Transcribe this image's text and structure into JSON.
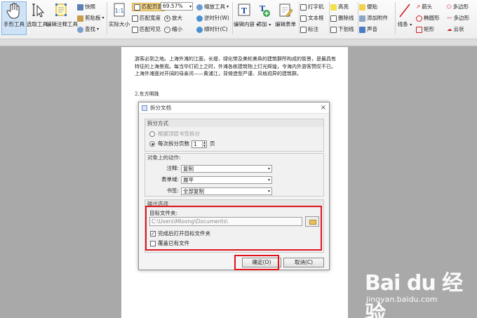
{
  "toolbar": {
    "hand_tool": "手形工具",
    "select_tool": "选取工具",
    "edit_annot_tool": "编辑注释工具",
    "snapshot": "快照",
    "clipboard": "剪贴板",
    "find": "查找",
    "actual_size": "实际大小",
    "fit_page": "匹配页面",
    "fit_width": "匹配宽度",
    "fit_visible": "匹配可见",
    "zoom_value": "69.57%",
    "zoom_in": "放大",
    "zoom_out": "缩小",
    "zoom_tool": "缩放工具",
    "rotate_ccw": "逆时针(W)",
    "rotate_cw": "顺时针(C)",
    "edit_content": "编辑内容",
    "add": "添加",
    "edit_form": "编辑表单",
    "typewriter": "打字机",
    "textbox": "文本框",
    "callout": "标注",
    "highlight": "高亮",
    "strikeout": "删除线",
    "underline": "下划线",
    "sticky_note": "便贴",
    "attach_file": "添加附件",
    "sound": "声音",
    "line": "线条",
    "arrow": "箭头",
    "ellipse": "椭圆形",
    "rectangle": "矩形",
    "polygon": "多边形",
    "polyline": "多边形",
    "cloud": "云状"
  },
  "page": {
    "paragraph": "游客必到之地。上海外滩的江面，长堤、绿化带及美轮美奂的建筑群所构成的街景，是最具有特征的上海景观。每当华灯初上之时，外滩各栋建筑物上灯光辉煌，令海内外游客赞叹不已。上海外滩面对开阔的母亲河——黄浦江，背倚造型严谨、风格迥异的建筑群。",
    "heading": "2.东方明珠"
  },
  "dialog": {
    "title": "拆分文档",
    "close": "×",
    "split_section": "拆分方式",
    "by_bookmark": "根据顶层书签拆分",
    "each_pages_prefix": "每次拆分页数",
    "pages_value": "1",
    "pages_suffix": "页",
    "actions_section": "对象上的动作:",
    "annot_label": "注释:",
    "annot_value": "复制",
    "form_label": "表单域:",
    "form_value": "展平",
    "bookmark_label": "书签:",
    "bookmark_value": "全部复制",
    "output_section": "输出选项",
    "target_folder_label": "目标文件夹:",
    "target_folder_value": "C:\\Users\\Mloong\\Documents\\",
    "open_after": "完成后打开目标文件夹",
    "overwrite": "覆盖已有文件",
    "ok_button": "确定(O)",
    "cancel_button": "取消(C)"
  },
  "watermark": {
    "brand": "Bai du 经验",
    "url": "jingyan.baidu.com"
  },
  "colors": {
    "highlight_red": "#e0141e",
    "selected_tool_bg": "#cfe3f7"
  }
}
